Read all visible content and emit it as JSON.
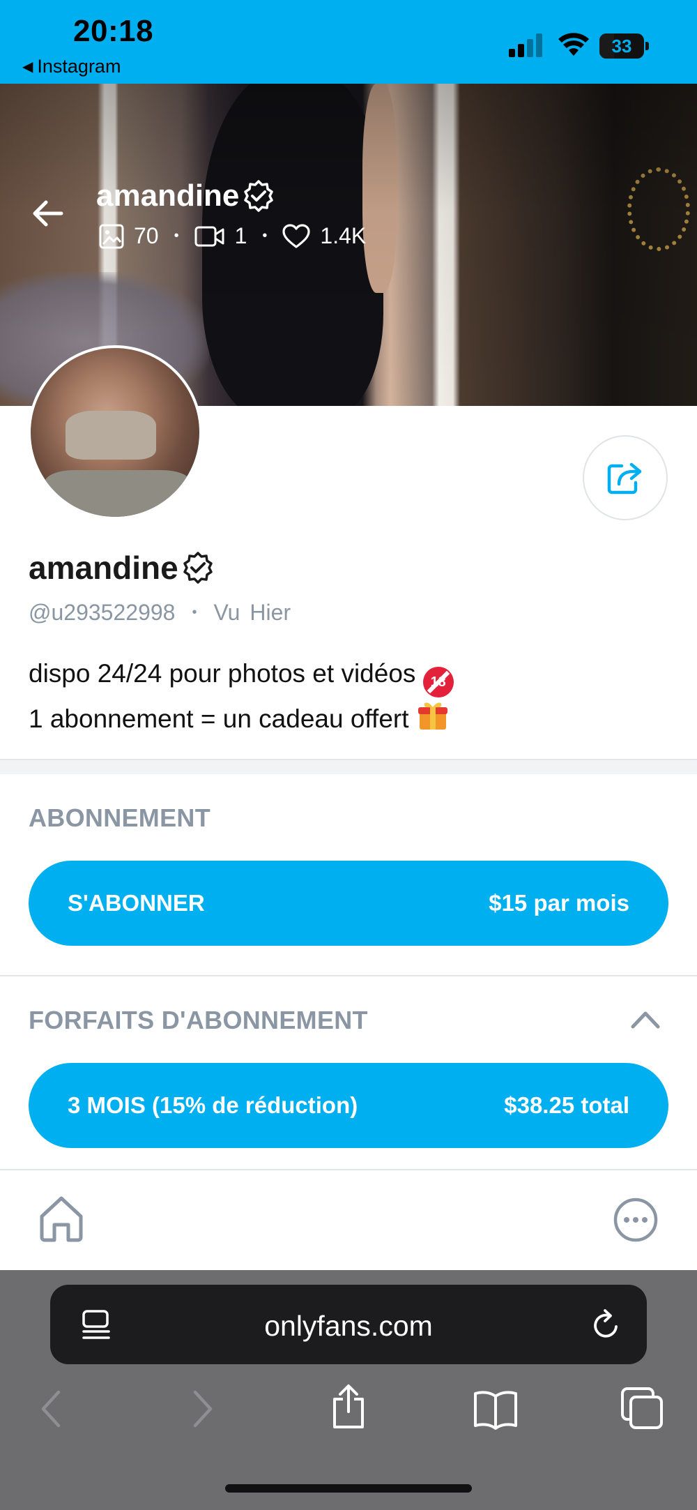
{
  "status_bar": {
    "time": "20:18",
    "back_app": "Instagram",
    "battery_level": "33",
    "icons": [
      "signal-icon",
      "wifi-icon",
      "battery-icon"
    ]
  },
  "cover": {
    "name": "amandine",
    "stats": {
      "photos": "70",
      "videos": "1",
      "likes": "1.4K"
    },
    "icons": [
      "back-arrow-icon",
      "verified-badge-icon",
      "photo-icon",
      "video-icon",
      "heart-icon"
    ]
  },
  "profile": {
    "name": "amandine",
    "handle": "@u293522998",
    "seen_prefix": "Vu",
    "seen_value": "Hier",
    "bio_line1": "dispo 24/24 pour photos et vidéos",
    "bio_line2": "1 abonnement = un cadeau offert"
  },
  "subscription": {
    "title": "ABONNEMENT",
    "button_label": "S'ABONNER",
    "button_price": "$15 par mois"
  },
  "bundles": {
    "title": "FORFAITS D'ABONNEMENT",
    "items": [
      {
        "label": "3 MOIS (15% de réduction)",
        "price": "$38.25 total"
      }
    ]
  },
  "browser": {
    "url": "onlyfans.com",
    "icons": [
      "reader-icon",
      "reload-icon",
      "back-icon",
      "forward-icon",
      "share-icon",
      "bookmarks-icon",
      "tabs-icon"
    ]
  },
  "colors": {
    "accent": "#00aff0",
    "muted_text": "#8a96a3",
    "url_bar": "#1c1c1e",
    "toolbar": "#6d6d6f"
  }
}
